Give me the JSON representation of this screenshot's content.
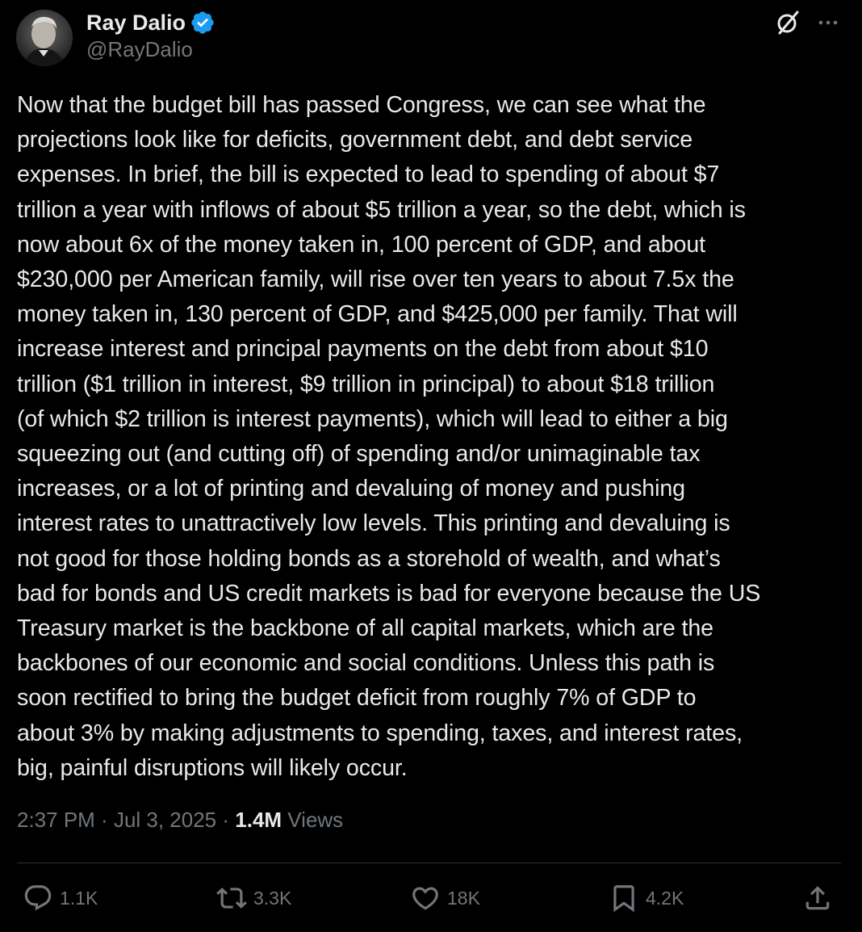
{
  "author": {
    "display_name": "Ray Dalio",
    "handle": "@RayDalio",
    "verified": true,
    "avatar_icon": "user-avatar"
  },
  "header_icons": {
    "grok": "grok-icon",
    "more": "more-icon"
  },
  "tweet": {
    "lines": [
      "Now that the budget bill has passed Congress, we can see what the",
      "projections look like for deficits, government debt, and debt service",
      "expenses. In brief, the bill is expected to lead to spending of about $7",
      "trillion a year with inflows of about $5 trillion a year, so the debt, which is",
      "now about 6x of the money taken in, 100 percent of GDP, and about",
      "$230,000 per American family, will rise over ten years to about 7.5x the",
      "money taken in, 130 percent of GDP, and $425,000 per family. That will",
      "increase interest and principal payments on the debt from about $10",
      "trillion ($1 trillion in interest, $9 trillion in principal) to about $18 trillion",
      "(of which $2 trillion is interest payments), which will lead to either a big",
      "squeezing out (and cutting off) of spending and/or unimaginable tax",
      "increases, or a lot of printing and devaluing of money and pushing",
      "interest rates to unattractively low levels. This printing and devaluing is",
      "not good for those holding bonds as a storehold of wealth, and what’s",
      "bad for bonds and US credit markets is bad for everyone because the US",
      "Treasury market is the backbone of all capital markets, which are the",
      "backbones of our economic and social conditions. Unless this path is",
      "soon rectified to bring the budget deficit from roughly 7% of GDP to",
      "about 3% by making adjustments to spending, taxes, and interest rates,",
      "big, painful disruptions will likely occur."
    ]
  },
  "meta": {
    "time": "2:37 PM",
    "separator": " · ",
    "date": "Jul 3, 2025",
    "views_count": "1.4M",
    "views_label": " Views"
  },
  "actions": {
    "reply_count": "1.1K",
    "repost_count": "3.3K",
    "like_count": "18K",
    "bookmark_count": "4.2K"
  },
  "colors": {
    "background": "#000000",
    "text": "#e7e9ea",
    "secondary": "#71767b",
    "divider": "#2f3336",
    "verified_badge": "#1d9bf0"
  }
}
